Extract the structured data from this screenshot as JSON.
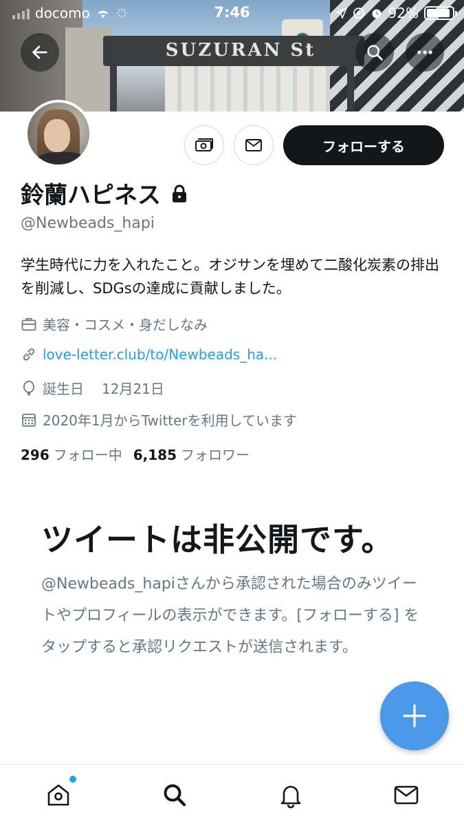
{
  "status_bar": {
    "carrier": "docomo",
    "time": "7:46",
    "battery": "92%"
  },
  "banner": {
    "sign_text": "SUZURAN St"
  },
  "profile": {
    "display_name": "鈴蘭ハピネス",
    "handle": "@Newbeads_hapi",
    "bio": "学生時代に力を入れたこと。オジサンを埋めて二酸化炭素の排出を削減し、SDGsの達成に貢献しました。",
    "category": "美容・コスメ・身だしなみ",
    "website": "love-letter.club/to/Newbeads_ha...",
    "birthday_label": "誕生日",
    "birthday": "12月21日",
    "joined": "2020年1月からTwitterを利用しています",
    "following_count": "296",
    "following_label": "フォロー中",
    "followers_count": "6,185",
    "followers_label": "フォロワー",
    "follow_button": "フォローする",
    "protected": true
  },
  "protected_notice": {
    "title": "ツイートは非公開です。",
    "description": "@Newbeads_hapiさんから承認された場合のみツイートやプロフィールの表示ができます。[フォローする] をタップすると承認リクエストが送信されます。"
  },
  "tabbar": {
    "items": [
      "home-icon",
      "search-icon",
      "notifications-icon",
      "messages-icon"
    ],
    "home_has_notification": true
  },
  "colors": {
    "accent": "#1da1f2",
    "fab": "#4a99e9",
    "text": "#14171a",
    "secondary": "#657786"
  }
}
